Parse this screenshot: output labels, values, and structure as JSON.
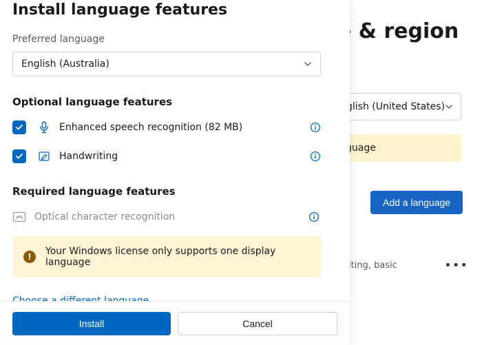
{
  "background": {
    "title_fragment": "e & region",
    "display_lang": "glish (United States)",
    "yellow_fragment": "guage",
    "add_language": "Add a language",
    "row_text": "writing, basic"
  },
  "modal": {
    "title": "Install language features",
    "preferred_label": "Preferred language",
    "selected_language": "English (Australia)",
    "optional_heading": "Optional language features",
    "features": {
      "speech": {
        "label": "Enhanced speech recognition (82 MB)",
        "checked": true
      },
      "handwriting": {
        "label": "Handwriting",
        "checked": true
      }
    },
    "required_heading": "Required language features",
    "ocr": {
      "label": "Optical character recognition"
    },
    "banner": "Your Windows license only supports one display language",
    "choose_link": "Choose a different language",
    "install": "Install",
    "cancel": "Cancel"
  },
  "colors": {
    "accent": "#0067c0",
    "banner_bg": "#fff5d6",
    "banner_icon": "#8a5a00"
  }
}
